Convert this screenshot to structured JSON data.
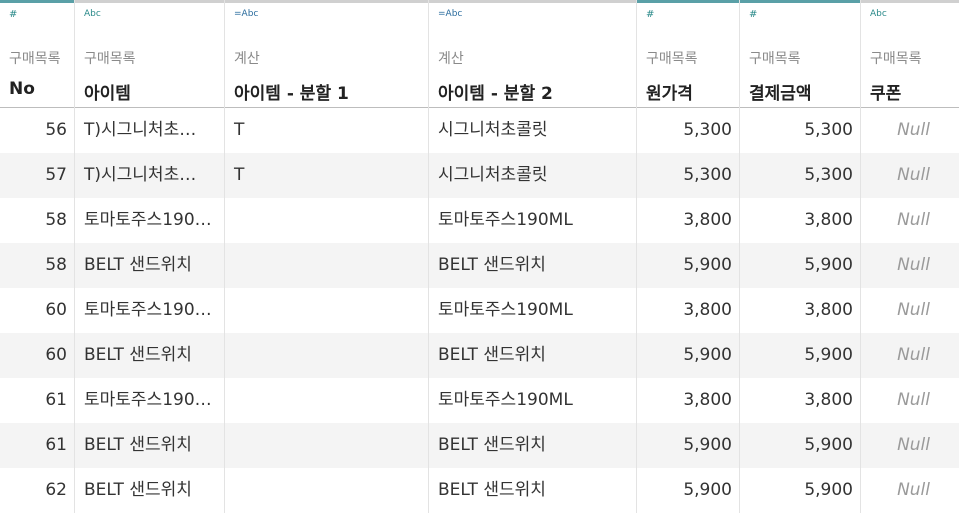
{
  "accent_colors": {
    "numeric": "#5aa0a7",
    "string": "#d0d0d0"
  },
  "columns": [
    {
      "type_icon": "#",
      "source": "구매목록",
      "name": "No"
    },
    {
      "type_icon": "Abc",
      "source": "구매목록",
      "name": "아이템"
    },
    {
      "type_icon": "=Abc",
      "source": "계산",
      "name": "아이템 - 분할 1"
    },
    {
      "type_icon": "=Abc",
      "source": "계산",
      "name": "아이템 - 분할 2"
    },
    {
      "type_icon": "#",
      "source": "구매목록",
      "name": "원가격"
    },
    {
      "type_icon": "#",
      "source": "구매목록",
      "name": "결제금액"
    },
    {
      "type_icon": "Abc",
      "source": "구매목록",
      "name": "쿠폰"
    }
  ],
  "rows": [
    [
      "56",
      "T)시그니처초…",
      "T",
      "시그니처초콜릿",
      "5,300",
      "5,300",
      "Null"
    ],
    [
      "57",
      "T)시그니처초…",
      "T",
      "시그니처초콜릿",
      "5,300",
      "5,300",
      "Null"
    ],
    [
      "58",
      "토마토주스190…",
      "",
      "토마토주스190ML",
      "3,800",
      "3,800",
      "Null"
    ],
    [
      "58",
      "BELT 샌드위치",
      "",
      "BELT 샌드위치",
      "5,900",
      "5,900",
      "Null"
    ],
    [
      "60",
      "토마토주스190…",
      "",
      "토마토주스190ML",
      "3,800",
      "3,800",
      "Null"
    ],
    [
      "60",
      "BELT 샌드위치",
      "",
      "BELT 샌드위치",
      "5,900",
      "5,900",
      "Null"
    ],
    [
      "61",
      "토마토주스190…",
      "",
      "토마토주스190ML",
      "3,800",
      "3,800",
      "Null"
    ],
    [
      "61",
      "BELT 샌드위치",
      "",
      "BELT 샌드위치",
      "5,900",
      "5,900",
      "Null"
    ],
    [
      "62",
      "BELT 샌드위치",
      "",
      "BELT 샌드위치",
      "5,900",
      "5,900",
      "Null"
    ]
  ]
}
